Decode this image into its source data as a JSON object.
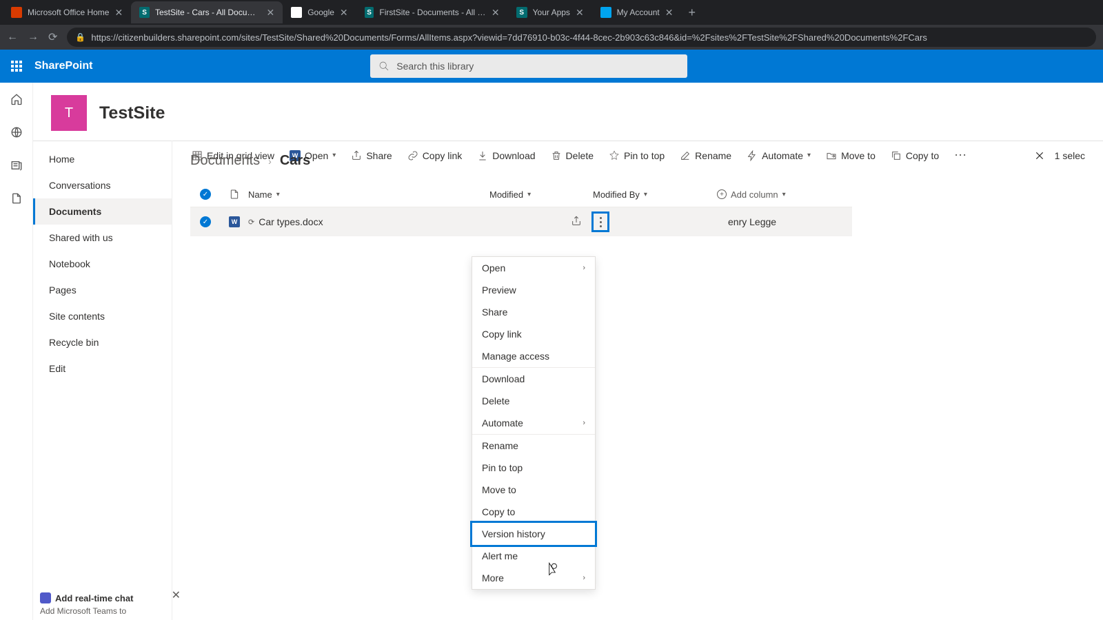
{
  "browser": {
    "tabs": [
      {
        "label": "Microsoft Office Home",
        "active": false,
        "favicon_bg": "#d83b01",
        "favicon_text": ""
      },
      {
        "label": "TestSite - Cars - All Documents",
        "active": true,
        "favicon_bg": "#036c70",
        "favicon_text": "S"
      },
      {
        "label": "Google",
        "active": false,
        "favicon_bg": "#fff",
        "favicon_text": "G"
      },
      {
        "label": "FirstSite - Documents - All Docum",
        "active": false,
        "favicon_bg": "#036c70",
        "favicon_text": "S"
      },
      {
        "label": "Your Apps",
        "active": false,
        "favicon_bg": "#036c70",
        "favicon_text": "S"
      },
      {
        "label": "My Account",
        "active": false,
        "favicon_bg": "#00a4ef",
        "favicon_text": ""
      }
    ],
    "url": "https://citizenbuilders.sharepoint.com/sites/TestSite/Shared%20Documents/Forms/AllItems.aspx?viewid=7dd76910-b03c-4f44-8cec-2b903c63c846&id=%2Fsites%2FTestSite%2FShared%20Documents%2FCars"
  },
  "suite": {
    "title": "SharePoint",
    "search_placeholder": "Search this library"
  },
  "site": {
    "initial": "T",
    "name": "TestSite"
  },
  "commands": {
    "edit_grid": "Edit in grid view",
    "open": "Open",
    "share": "Share",
    "copy_link": "Copy link",
    "download": "Download",
    "delete": "Delete",
    "pin": "Pin to top",
    "rename": "Rename",
    "automate": "Automate",
    "move": "Move to",
    "copy_to": "Copy to",
    "selected": "1 selec"
  },
  "nav": {
    "items": [
      "Home",
      "Conversations",
      "Documents",
      "Shared with us",
      "Notebook",
      "Pages",
      "Site contents",
      "Recycle bin",
      "Edit"
    ],
    "active_index": 2
  },
  "breadcrumb": {
    "root": "Documents",
    "current": "Cars"
  },
  "columns": {
    "name": "Name",
    "modified": "Modified",
    "modified_by": "Modified By",
    "add": "Add column"
  },
  "row": {
    "filename": "Car types.docx",
    "modified_by": "enry Legge"
  },
  "context_menu": {
    "groups": [
      [
        "Open",
        "Preview",
        "Share",
        "Copy link",
        "Manage access"
      ],
      [
        "Download",
        "Delete",
        "Automate"
      ],
      [
        "Rename",
        "Pin to top",
        "Move to",
        "Copy to",
        "Version history",
        "Alert me",
        "More"
      ]
    ],
    "submenu_items": [
      "Open",
      "Automate",
      "More"
    ],
    "highlighted": "Version history"
  },
  "promo": {
    "title": "Add real-time chat",
    "body": "Add Microsoft Teams to"
  }
}
